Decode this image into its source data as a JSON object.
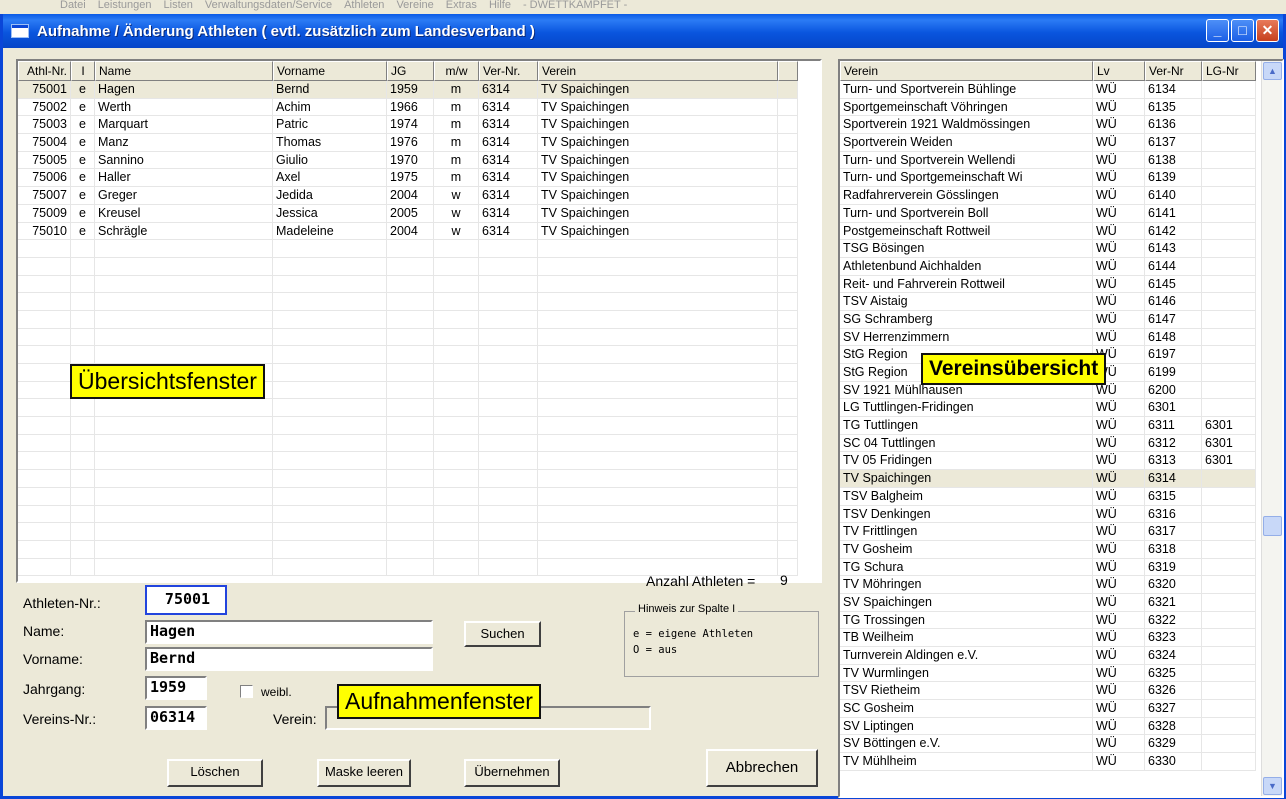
{
  "background_menu": [
    "Datei",
    "Leistungen",
    "Listen",
    "Verwaltungsdaten/Service",
    "Athleten",
    "Vereine",
    "Extras",
    "Hilfe",
    "- DWETTKAMPFET -"
  ],
  "window": {
    "title": "Aufnahme / Änderung Athleten ( evtl. zusätzlich zum Landesverband )",
    "buttons": {
      "minimize": "_",
      "maximize": "□",
      "close": "✕"
    }
  },
  "athletes": {
    "columns": [
      "Athl-Nr.",
      "I",
      "Name",
      "Vorname",
      "JG",
      "m/w",
      "Ver-Nr.",
      "Verein"
    ],
    "selected_index": 0,
    "rows": [
      [
        "75001",
        "e",
        "Hagen",
        "Bernd",
        "1959",
        "m",
        "6314",
        "TV Spaichingen"
      ],
      [
        "75002",
        "e",
        "Werth",
        "Achim",
        "1966",
        "m",
        "6314",
        "TV Spaichingen"
      ],
      [
        "75003",
        "e",
        "Marquart",
        "Patric",
        "1974",
        "m",
        "6314",
        "TV Spaichingen"
      ],
      [
        "75004",
        "e",
        "Manz",
        "Thomas",
        "1976",
        "m",
        "6314",
        "TV Spaichingen"
      ],
      [
        "75005",
        "e",
        "Sannino",
        "Giulio",
        "1970",
        "m",
        "6314",
        "TV Spaichingen"
      ],
      [
        "75006",
        "e",
        "Haller",
        "Axel",
        "1975",
        "m",
        "6314",
        "TV Spaichingen"
      ],
      [
        "75007",
        "e",
        "Greger",
        "Jedida",
        "2004",
        "w",
        "6314",
        "TV Spaichingen"
      ],
      [
        "75009",
        "e",
        "Kreusel",
        "Jessica",
        "2005",
        "w",
        "6314",
        "TV Spaichingen"
      ],
      [
        "75010",
        "e",
        "Schrägle",
        "Madeleine",
        "2004",
        "w",
        "6314",
        "TV Spaichingen"
      ]
    ]
  },
  "clubs": {
    "columns": [
      "Verein",
      "Lv",
      "Ver-Nr",
      "LG-Nr"
    ],
    "selected_ver_nr": "6314",
    "rows": [
      [
        "Turn- und Sportverein Bühlinge",
        "WÜ",
        "6134",
        ""
      ],
      [
        "Sportgemeinschaft Vöhringen",
        "WÜ",
        "6135",
        ""
      ],
      [
        "Sportverein 1921 Waldmössingen",
        "WÜ",
        "6136",
        ""
      ],
      [
        "Sportverein Weiden",
        "WÜ",
        "6137",
        ""
      ],
      [
        "Turn- und Sportverein Wellendi",
        "WÜ",
        "6138",
        ""
      ],
      [
        "Turn- und Sportgemeinschaft Wi",
        "WÜ",
        "6139",
        ""
      ],
      [
        "Radfahrerverein Gösslingen",
        "WÜ",
        "6140",
        ""
      ],
      [
        "Turn- und Sportverein Boll",
        "WÜ",
        "6141",
        ""
      ],
      [
        "Postgemeinschaft Rottweil",
        "WÜ",
        "6142",
        ""
      ],
      [
        "TSG Bösingen",
        "WÜ",
        "6143",
        ""
      ],
      [
        "Athletenbund Aichhalden",
        "WÜ",
        "6144",
        ""
      ],
      [
        "Reit- und Fahrverein Rottweil",
        "WÜ",
        "6145",
        ""
      ],
      [
        "TSV Aistaig",
        "WÜ",
        "6146",
        ""
      ],
      [
        "SG Schramberg",
        "WÜ",
        "6147",
        ""
      ],
      [
        "SV Herrenzimmern",
        "WÜ",
        "6148",
        ""
      ],
      [
        "StG Region",
        "WÜ",
        "6197",
        ""
      ],
      [
        "StG Region",
        "WÜ",
        "6199",
        ""
      ],
      [
        "SV 1921 Mühlhausen",
        "WÜ",
        "6200",
        ""
      ],
      [
        "LG Tuttlingen-Fridingen",
        "WÜ",
        "6301",
        ""
      ],
      [
        "TG Tuttlingen",
        "WÜ",
        "6311",
        "6301"
      ],
      [
        "SC 04 Tuttlingen",
        "WÜ",
        "6312",
        "6301"
      ],
      [
        "TV 05 Fridingen",
        "WÜ",
        "6313",
        "6301"
      ],
      [
        "TV Spaichingen",
        "WÜ",
        "6314",
        ""
      ],
      [
        "TSV Balgheim",
        "WÜ",
        "6315",
        ""
      ],
      [
        "TSV Denkingen",
        "WÜ",
        "6316",
        ""
      ],
      [
        "TV Frittlingen",
        "WÜ",
        "6317",
        ""
      ],
      [
        "TV Gosheim",
        "WÜ",
        "6318",
        ""
      ],
      [
        "TG Schura",
        "WÜ",
        "6319",
        ""
      ],
      [
        "TV Möhringen",
        "WÜ",
        "6320",
        ""
      ],
      [
        "SV Spaichingen",
        "WÜ",
        "6321",
        ""
      ],
      [
        "TG Trossingen",
        "WÜ",
        "6322",
        ""
      ],
      [
        "TB Weilheim",
        "WÜ",
        "6323",
        ""
      ],
      [
        "Turnverein Aldingen e.V.",
        "WÜ",
        "6324",
        ""
      ],
      [
        "TV Wurmlingen",
        "WÜ",
        "6325",
        ""
      ],
      [
        "TSV Rietheim",
        "WÜ",
        "6326",
        ""
      ],
      [
        "SC Gosheim",
        "WÜ",
        "6327",
        ""
      ],
      [
        "SV Liptingen",
        "WÜ",
        "6328",
        ""
      ],
      [
        "SV Böttingen e.V.",
        "WÜ",
        "6329",
        ""
      ],
      [
        "TV Mühlheim",
        "WÜ",
        "6330",
        ""
      ]
    ]
  },
  "form": {
    "count_label": "Anzahl Athleten =",
    "count_value": "9",
    "athlete_no_label": "Athleten-Nr.:",
    "athlete_no_value": "75001",
    "name_label": "Name:",
    "name_value": "Hagen",
    "vorname_label": "Vorname:",
    "vorname_value": "Bernd",
    "jahrgang_label": "Jahrgang:",
    "jahrgang_value": "1959",
    "weibl_label": "weibl.",
    "weibl_checked": false,
    "vereins_nr_label": "Vereins-Nr.:",
    "vereins_nr_value": "06314",
    "verein_label": "Verein:",
    "verein_value": "",
    "suchen_button": "Suchen",
    "hint_title": "Hinweis zur Spalte  I",
    "hint_line1": "e = eigene Athleten",
    "hint_line2": "O = aus"
  },
  "buttons": {
    "delete": "Löschen",
    "clear": "Maske leeren",
    "apply": "Übernehmen",
    "cancel": "Abbrechen"
  },
  "callouts": {
    "overview": "Übersichtsfenster",
    "clubs": "Vereinsübersicht",
    "entry": "Aufnahmenfenster"
  }
}
